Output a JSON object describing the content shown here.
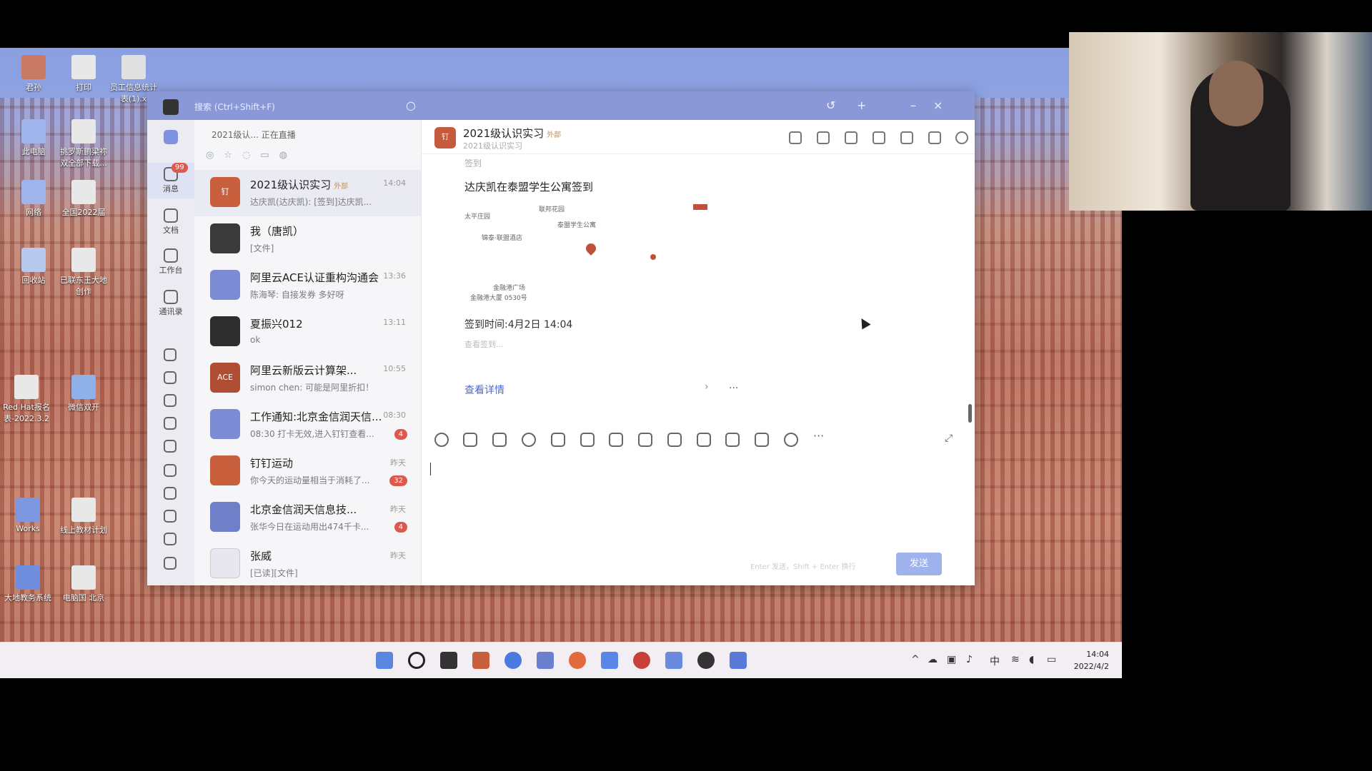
{
  "desktop": {
    "icons": [
      {
        "label": "君孙"
      },
      {
        "label": "打印"
      },
      {
        "label": "员工信息统计表(1).x"
      },
      {
        "label": "此电脑"
      },
      {
        "label": "挑罗斯鹏梁祢双全部下载..."
      },
      {
        "label": "网络"
      },
      {
        "label": "全国2022届"
      },
      {
        "label": "回收站"
      },
      {
        "label": "已联东王大地创作"
      },
      {
        "label": "Red Hat报名表-2022.3.2"
      },
      {
        "label": "微信双开"
      },
      {
        "label": "Works"
      },
      {
        "label": "线上教材计划"
      },
      {
        "label": "大地教务系统"
      },
      {
        "label": "电脑国 北京"
      }
    ]
  },
  "app": {
    "titlebar": {
      "text": "搜索 (Ctrl+Shift+F)"
    },
    "nav": [
      {
        "label": "消息",
        "badge": "99"
      },
      {
        "label": "文档"
      },
      {
        "label": "工作台"
      },
      {
        "label": "通讯录"
      }
    ],
    "list": {
      "status": "2021级认... 正在直播",
      "conversations": [
        {
          "name": "2021级认识实习",
          "tag": "外部",
          "preview": "达庆凯(达庆凯): [签到]达庆凯...",
          "time": "14:04",
          "avatar": "钉",
          "color": "#c8603e"
        },
        {
          "name": "我（唐凯）",
          "tag": "",
          "preview": "[文件]",
          "time": "",
          "avatar": "",
          "color": "#3a3a3a"
        },
        {
          "name": "阿里云ACE认证重构沟通会",
          "tag": "",
          "preview": "陈海琴: 自接发券 多好呀",
          "time": "13:36",
          "avatar": "",
          "color": "#7c8bd4"
        },
        {
          "name": "夏振兴012",
          "tag": "",
          "preview": "ok",
          "time": "13:11",
          "avatar": "",
          "color": "#2d2d2d"
        },
        {
          "name": "阿里云新版云计算架...",
          "tag": "",
          "preview": "simon chen: 可能是阿里折扣！",
          "time": "10:55",
          "avatar": "ACE",
          "color": "#b04e34"
        },
        {
          "name": "工作通知:北京金信润天信...",
          "tag": "",
          "preview": "08:30 打卡无效,进入钉钉查看...",
          "time": "08:30",
          "count": "4",
          "avatar": "",
          "color": "#7c8bd4"
        },
        {
          "name": "钉钉运动",
          "tag": "",
          "preview": "你今天的运动量相当于消耗了...",
          "time": "昨天",
          "count": "32",
          "avatar": "",
          "color": "#c8603e"
        },
        {
          "name": "北京金信润天信息技...",
          "tag": "",
          "preview": "张华今日在运动用出474千卡...",
          "time": "昨天",
          "count": "4",
          "avatar": "",
          "color": "#6f7fc8"
        },
        {
          "name": "张威",
          "tag": "",
          "preview": "[已读][文件]",
          "time": "昨天",
          "avatar": "",
          "color": "#e8e6ee"
        }
      ]
    },
    "chat": {
      "title": "2021级认识实习",
      "title_tag": "外部",
      "subtitle": "2021级认识实习",
      "card": {
        "top": "签到",
        "title": "达庆凯在泰盟学生公寓签到",
        "time": "签到时间:4月2日 14:04",
        "note": "查看签到...",
        "link": "查看详情",
        "more": "...",
        "map_labels": [
          "太平庄园",
          "联邦花园",
          "泰盟学生公寓",
          "锦泰·联盟酒店",
          "金融港广场",
          "金融港大厦 0530号"
        ]
      },
      "send": "发送",
      "send_hint": "Enter 发送，Shift + Enter 换行"
    }
  },
  "taskbar": {
    "time": "14:04",
    "date": "2022/4/2",
    "ime": "中"
  }
}
